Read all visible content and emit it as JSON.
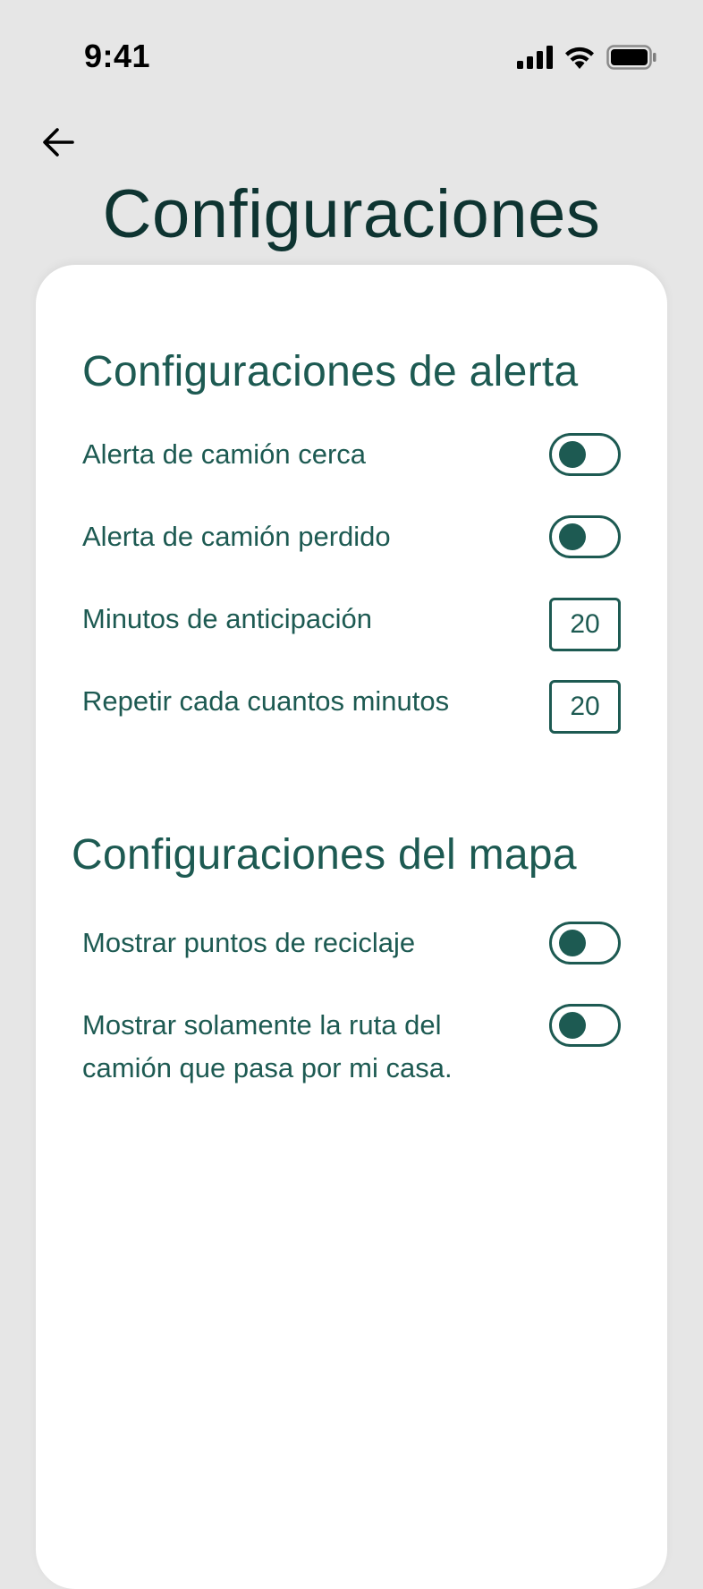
{
  "status_bar": {
    "time": "9:41"
  },
  "header": {
    "back_icon": "arrow-left-icon",
    "title": "Configuraciones"
  },
  "alert_settings": {
    "title": "Configuraciones de alerta",
    "truck_near_alert": {
      "label": "Alerta de camión cerca",
      "enabled": false
    },
    "truck_lost_alert": {
      "label": "Alerta de camión perdido",
      "enabled": false
    },
    "advance_minutes": {
      "label": "Minutos de anticipación",
      "value": "20"
    },
    "repeat_minutes": {
      "label": "Repetir cada cuantos minutos",
      "value": "20"
    }
  },
  "map_settings": {
    "title": "Configuraciones del mapa",
    "show_recycling_points": {
      "label": "Mostrar puntos de reciclaje",
      "enabled": false
    },
    "show_my_route_only": {
      "label_line1": "Mostrar solamente la ruta del",
      "label_line2": "camión que pasa por mi casa.",
      "enabled": false
    }
  },
  "colors": {
    "accent": "#1d5a52",
    "title": "#0e3431",
    "background": "#e6e6e6",
    "card": "#ffffff"
  }
}
